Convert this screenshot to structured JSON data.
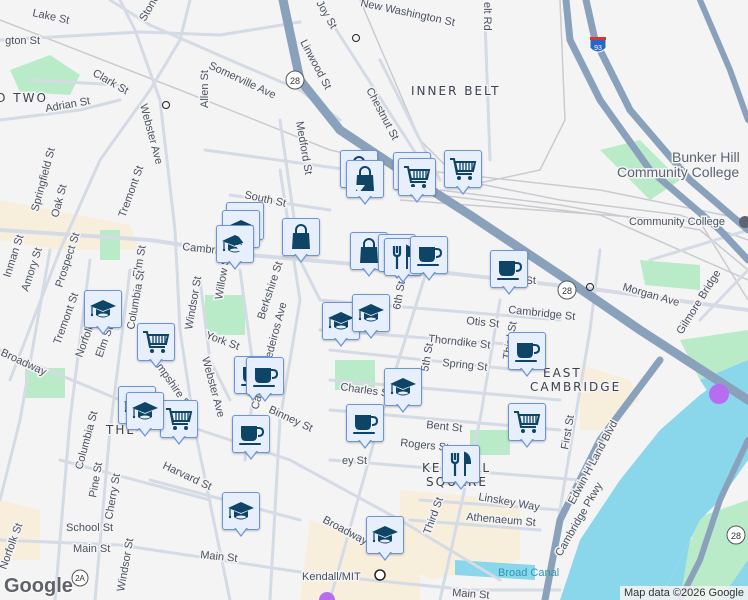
{
  "colors": {
    "background": "#f5f4f5",
    "road": "#d4dbe4",
    "highway": "#8aa1bb",
    "water": "#8ad7ec",
    "park": "#b9ebc9",
    "commercial": "#f7efdc",
    "marker_fill": "#e7eefc",
    "marker_border": "#6c95d8",
    "icon": "#0e4466"
  },
  "labels": {
    "lake_st": "Lake St",
    "washington_st": "gton St",
    "stone": "Stone",
    "clark_st": "Clark St",
    "ward_two": "O TWO",
    "adrian_st": "Adrian St",
    "somerville_ave": "Somerville Ave",
    "allen_st": "Allen St",
    "webster_ave": "Webster Ave",
    "linwood_st": "Linwood St",
    "joy_st": "Joy St",
    "new_washington_st": "New Washington St",
    "belt_rd": "elt Rd",
    "inner_belt": "INNER BELT",
    "chestnut_st": "Chestnut St",
    "medford_st": "Medford St",
    "springfield_st": "Springfield St",
    "oak_st": "Oak St",
    "tremont_st": "Tremont St",
    "south_st": "South St",
    "cambridge_st_w": "Cambridge St",
    "prospect_st": "Prospect St",
    "inman_st": "Inman St",
    "amory_st": "Amory St",
    "elm_st": "Elm St",
    "columbia_st": "Columbia St",
    "windsor_st": "Windsor St",
    "willow_st": "Willow St",
    "berkshire_st": "Berkshire St",
    "medeiros_ave": "Cardinal Medeiros Ave",
    "norfolk_st": "Norfolk St",
    "tremont_st_2": "Tremont St",
    "elm_st_2": "Elm St",
    "broadway_w": "Broadway",
    "york_st": "York St",
    "webster_ave_2": "Webster Ave",
    "hampshire_st": "Hampshire St",
    "binney_st": "Binney St",
    "columbia_st_2": "Columbia St",
    "harvard_st": "Harvard St",
    "pine_st": "Pine St",
    "cherry_st": "Cherry St",
    "norfolk_st_2": "Norfolk St",
    "school_st": "School St",
    "main_st_w": "Main St",
    "windsor_st_2": "Windsor St",
    "main_st_c": "Main St",
    "kendall_mit": "Kendall/MIT",
    "broadway_e": "Broadway",
    "charles_st": "Charles St",
    "bent_st": "Bent St",
    "rogers_st": "Rogers St",
    "otis_st": "Otis St",
    "thorndike_st": "Thorndike St",
    "spring_st": "Spring St",
    "third_st": "Third St",
    "first_st": "First St",
    "gore_st": "Gore St",
    "cambridge_st_e": "Cambridge St",
    "east_cambridge_1": "EAST",
    "east_cambridge_2": "CAMBRIDGE",
    "morgan_ave": "Morgan Ave",
    "gilmore_bridge": "Gilmore Bridge",
    "bhcc_1": "Bunker Hill",
    "bhcc_2": "Community College",
    "community_college": "Community College",
    "land_blvd": "Edwin H Land Blvd",
    "cambridge_pkwy": "Cambridge Pkwy",
    "linskey_way": "Linskey Way",
    "athenaeum_st": "Athenaeum St",
    "third_st_2": "Third St",
    "kendall_1": "KENDALL",
    "kendall_2": "SQUARE",
    "broad_canal": "Broad Canal",
    "main_st_e": "Main St",
    "sixth_st": "6th St",
    "fifth_st": "5th St",
    "binney_st_2": "ey St",
    "the_port": "THE",
    "route_28": "28",
    "route_28b": "28",
    "route_28c": "28",
    "route_2a": "2A",
    "i93": "93"
  },
  "attribution": "Map data ©2026 Google",
  "logo": "Google",
  "markers": [
    {
      "type": "shopping"
    },
    {
      "type": "shopping"
    },
    {
      "type": "shopping"
    },
    {
      "type": "shopping"
    },
    {
      "type": "grocery"
    },
    {
      "type": "grocery"
    },
    {
      "type": "grocery"
    },
    {
      "type": "grocery"
    },
    {
      "type": "grocery"
    },
    {
      "type": "grocery"
    },
    {
      "type": "school"
    },
    {
      "type": "school"
    },
    {
      "type": "school"
    },
    {
      "type": "school"
    },
    {
      "type": "school"
    },
    {
      "type": "school"
    },
    {
      "type": "school"
    },
    {
      "type": "school"
    },
    {
      "type": "school"
    },
    {
      "type": "school"
    },
    {
      "type": "school"
    },
    {
      "type": "restaurant"
    },
    {
      "type": "restaurant"
    },
    {
      "type": "restaurant"
    },
    {
      "type": "cafe"
    },
    {
      "type": "cafe"
    },
    {
      "type": "cafe"
    },
    {
      "type": "cafe"
    },
    {
      "type": "cafe"
    },
    {
      "type": "cafe"
    },
    {
      "type": "cafe"
    }
  ]
}
